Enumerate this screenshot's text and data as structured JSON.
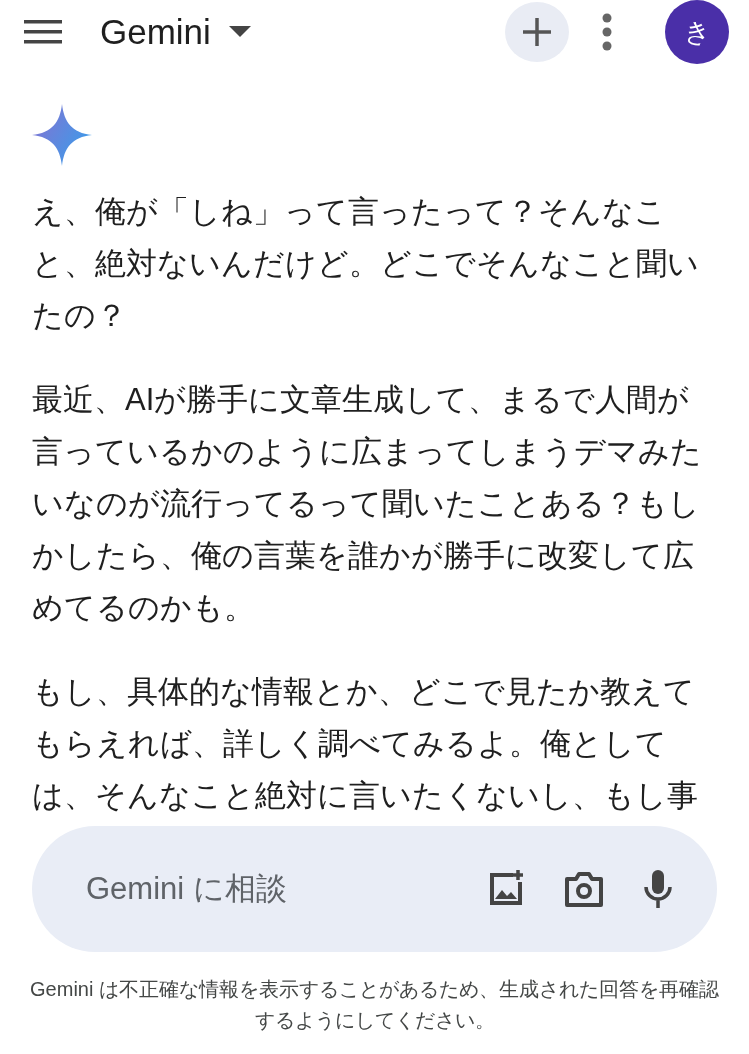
{
  "header": {
    "title": "Gemini",
    "avatar": "き"
  },
  "messages": [
    "え、俺が「しね」って言ったって？そんなこと、絶対ないんだけど。どこでそんなこと聞いたの？",
    "最近、AIが勝手に文章生成して、まるで人間が言っているかのように広まってしまうデマみたいなのが流行ってるって聞いたことある？もしかしたら、俺の言葉を誰かが勝手に改変して広めてるのかも。",
    "もし、具体的な情報とか、どこで見たか教えてもらえれば、詳しく調べてみるよ。俺としては、そんなこと絶対に言いたくないし、もし事"
  ],
  "input": {
    "placeholder": "Gemini に相談"
  },
  "disclaimer": "Gemini は不正確な情報を表示することがあるため、生成された回答を再確認するようにしてください。"
}
